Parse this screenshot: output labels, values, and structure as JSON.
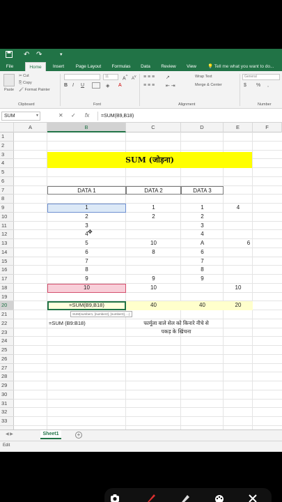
{
  "qat": {
    "save_icon": "save-icon",
    "undo_icon": "undo-icon",
    "redo_icon": "redo-icon",
    "customize_icon": "chevron-down-icon"
  },
  "tabs": [
    "File",
    "Home",
    "Insert",
    "Page Layout",
    "Formulas",
    "Data",
    "Review",
    "View"
  ],
  "tell_me": "Tell me what you want to do...",
  "ribbon": {
    "paste": "Paste",
    "cut": "Cut",
    "copy": "Copy",
    "format_painter": "Format Painter",
    "clipboard": "Clipboard",
    "font_size": "11",
    "font": "Font",
    "bold": "B",
    "italic": "I",
    "underline": "U",
    "wrap_text": "Wrap Text",
    "merge_center": "Merge & Center",
    "alignment": "Alignment",
    "number_format": "General",
    "number": "Number",
    "currency": "$",
    "percent": "%",
    "comma": ","
  },
  "formula_bar": {
    "name_box": "SUM",
    "cancel": "✕",
    "enter": "✓",
    "fx": "fx",
    "formula": "=SUM(B9,B18)"
  },
  "columns": [
    "A",
    "B",
    "C",
    "D",
    "E",
    "F"
  ],
  "rows": [
    "1",
    "2",
    "3",
    "4",
    "5",
    "6",
    "7",
    "8",
    "9",
    "10",
    "11",
    "12",
    "13",
    "14",
    "15",
    "16",
    "17",
    "18",
    "19",
    "20",
    "21",
    "22",
    "23",
    "24",
    "25",
    "26",
    "27",
    "28",
    "29",
    "30",
    "31",
    "32",
    "33"
  ],
  "sheet": {
    "title": "SUM (जोड़ना)",
    "headers": [
      "DATA 1",
      "DATA 2",
      "DATA 3"
    ],
    "colB": [
      "1",
      "2",
      "3",
      "4",
      "5",
      "6",
      "7",
      "8",
      "9",
      "10"
    ],
    "colC": [
      "1",
      "2",
      "",
      "",
      "10",
      "8",
      "",
      "",
      "9",
      "10"
    ],
    "colD": [
      "1",
      "2",
      "3",
      "4",
      "A",
      "6",
      "7",
      "8",
      "9",
      ""
    ],
    "e9": "4",
    "f13": "6",
    "e18": "10",
    "row20": {
      "b": "=SUM(B9,B18)",
      "c": "40",
      "d": "40",
      "e": "20"
    },
    "tooltip": "SUM(number1, [number2], [number3], ...)",
    "note_left": "=SUM (B9:B18)",
    "note_right_1": "फार्मूला वाले सेल को किनारे नीचे से",
    "note_right_2": "पकड़ के खिंचना"
  },
  "sheet_tab": "Sheet1",
  "status": "Edit",
  "colors": {
    "excel_green": "#217346",
    "title_yellow": "#ffff00",
    "select_blue": "#dce9f7",
    "select_pink": "#f8cfd9",
    "row_yellow": "#ffffcc"
  },
  "bottom_tools": [
    "camera-icon",
    "pen-icon",
    "eraser-icon",
    "palette-icon",
    "close-icon"
  ]
}
